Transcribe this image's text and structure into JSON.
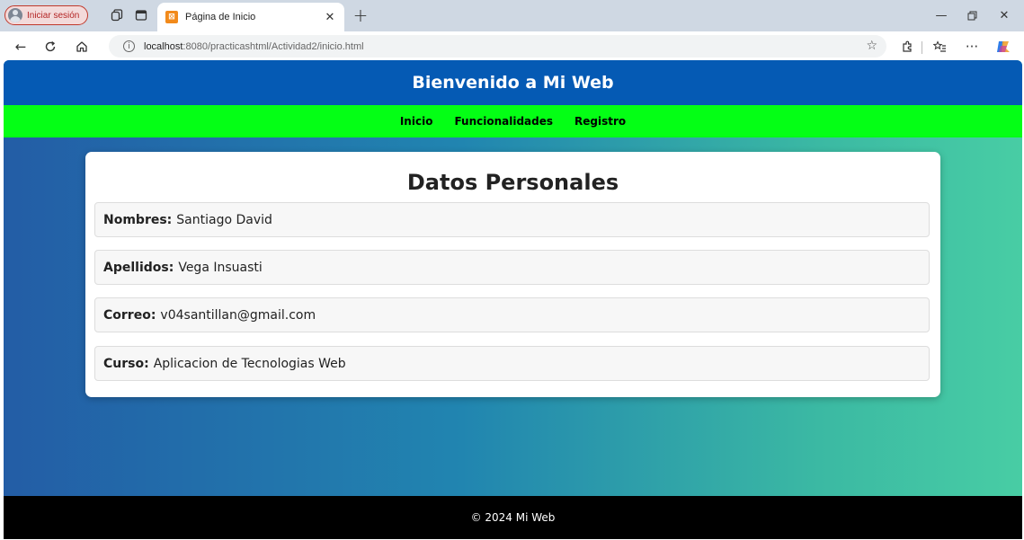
{
  "browser": {
    "signin_label": "Iniciar sesión",
    "tab_title": "Página de Inicio",
    "favicon_glyph": "⊠",
    "url_host": "localhost",
    "url_rest": ":8080/practicashtml/Actividad2/inicio.html"
  },
  "site": {
    "header_title": "Bienvenido a Mi Web",
    "nav": [
      {
        "label": "Inicio"
      },
      {
        "label": "Funcionalidades"
      },
      {
        "label": "Registro"
      }
    ],
    "card_title": "Datos Personales",
    "fields": [
      {
        "key": "Nombres:",
        "value": "Santiago David"
      },
      {
        "key": "Apellidos:",
        "value": "Vega Insuasti"
      },
      {
        "key": "Correo:",
        "value": "v04santillan@gmail.com"
      },
      {
        "key": "Curso:",
        "value": "Aplicacion de Tecnologias Web"
      }
    ],
    "footer": "© 2024 Mi Web"
  },
  "colors": {
    "header_bg": "#055ab4",
    "nav_bg": "#04ff15",
    "footer_bg": "#000000",
    "gradient_start": "#235da6",
    "gradient_end": "#48cda4"
  }
}
